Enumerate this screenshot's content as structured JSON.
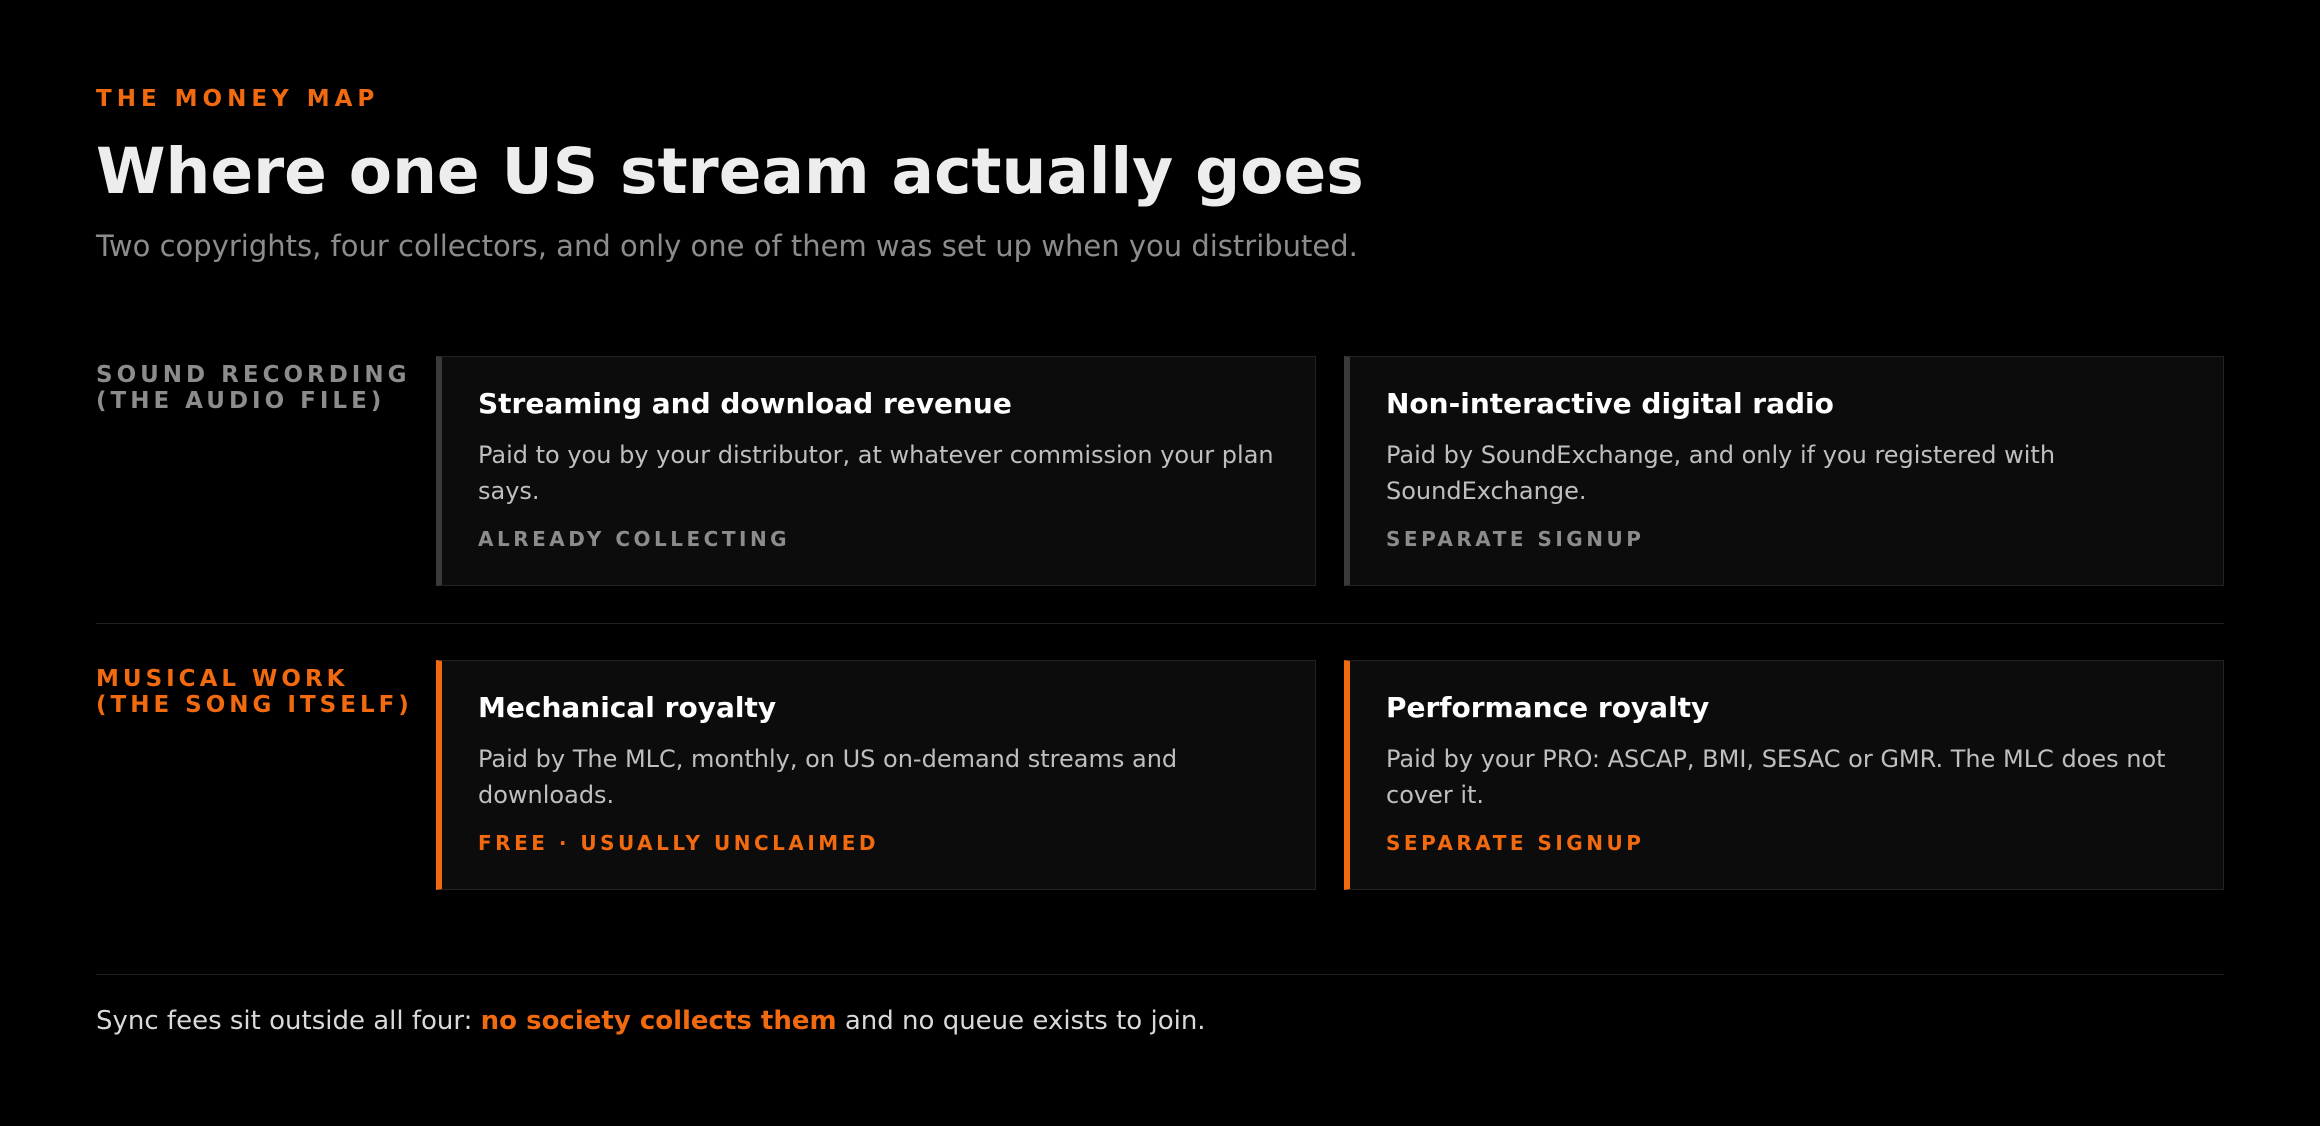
{
  "header": {
    "eyebrow": "THE MONEY MAP",
    "title": "Where one US stream actually goes",
    "subtitle": "Two copyrights, four collectors, and only one of them was set up when you distributed."
  },
  "rows": [
    {
      "label_line1": "SOUND RECORDING",
      "label_line2": "(THE AUDIO FILE)",
      "cards": [
        {
          "title": "Streaming and download revenue",
          "description": "Paid to you by your distributor, at whatever commission your plan says.",
          "tag": "ALREADY COLLECTING"
        },
        {
          "title": "Non-interactive digital radio",
          "description": "Paid by SoundExchange, and only if you registered with SoundExchange.",
          "tag": "SEPARATE SIGNUP"
        }
      ]
    },
    {
      "label_line1": "MUSICAL WORK",
      "label_line2": "(THE SONG ITSELF)",
      "cards": [
        {
          "title": "Mechanical royalty",
          "description": "Paid by The MLC, monthly, on US on-demand streams and downloads.",
          "tag": "FREE · USUALLY UNCLAIMED"
        },
        {
          "title": "Performance royalty",
          "description": "Paid by your PRO: ASCAP, BMI, SESAC or GMR. The MLC does not cover it.",
          "tag": "SEPARATE SIGNUP"
        }
      ]
    }
  ],
  "footer": {
    "before": "Sync fees sit outside all four: ",
    "emphasis": "no society collects them",
    "after": " and no queue exists to join."
  },
  "colors": {
    "background": "#000000",
    "accent": "#f26a0f",
    "muted": "#8c8c8c",
    "card_background": "#0c0c0c",
    "card_border": "#232323",
    "neutral_bar": "#3a3a3a"
  }
}
